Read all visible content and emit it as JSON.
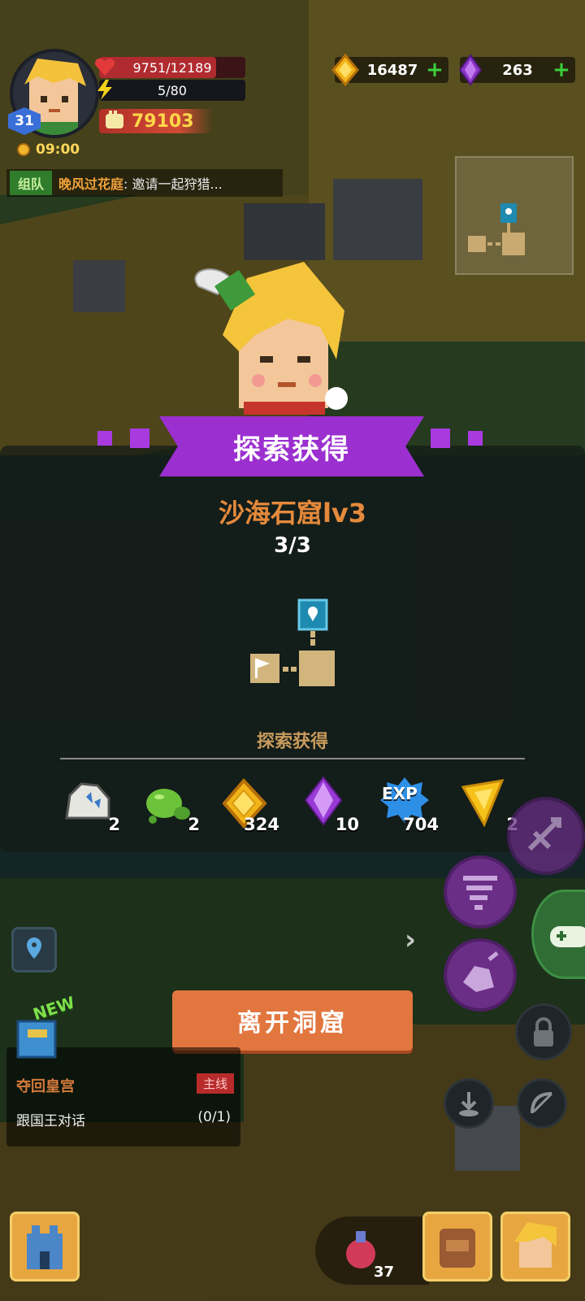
{
  "player": {
    "level": "31",
    "hp": "9751/12189",
    "hp_fraction": 0.8,
    "energy": "5/80",
    "power": "79103",
    "time": "09:00"
  },
  "chat": {
    "tag": "组队",
    "name": "晚风过花庭",
    "message": ": 邀请一起狩猎..."
  },
  "currency": {
    "gold": "16487",
    "gems": "263"
  },
  "result": {
    "banner": "探索获得",
    "dungeon_name": "沙海石窟lv3",
    "progress": "3/3",
    "loot_title": "探索获得",
    "items": [
      {
        "icon": "stone-ore-icon",
        "count": "2"
      },
      {
        "icon": "green-slime-icon",
        "count": "2"
      },
      {
        "icon": "gold-coin-icon",
        "count": "324"
      },
      {
        "icon": "purple-gem-icon",
        "count": "10"
      },
      {
        "icon": "exp-icon",
        "label": "EXP",
        "count": "704"
      },
      {
        "icon": "yellow-crystal-icon",
        "count": "2"
      }
    ]
  },
  "leave_button": "离开洞窟",
  "quest": {
    "new_label": "NEW",
    "title": "夺回皇宫",
    "tag": "主线",
    "desc": "跟国王对话",
    "progress": "(0/1)"
  },
  "potion_count": "37",
  "colors": {
    "banner": "#9b2fd0",
    "leave_button": "#e2763f",
    "dungeon_name": "#e58a3c"
  }
}
